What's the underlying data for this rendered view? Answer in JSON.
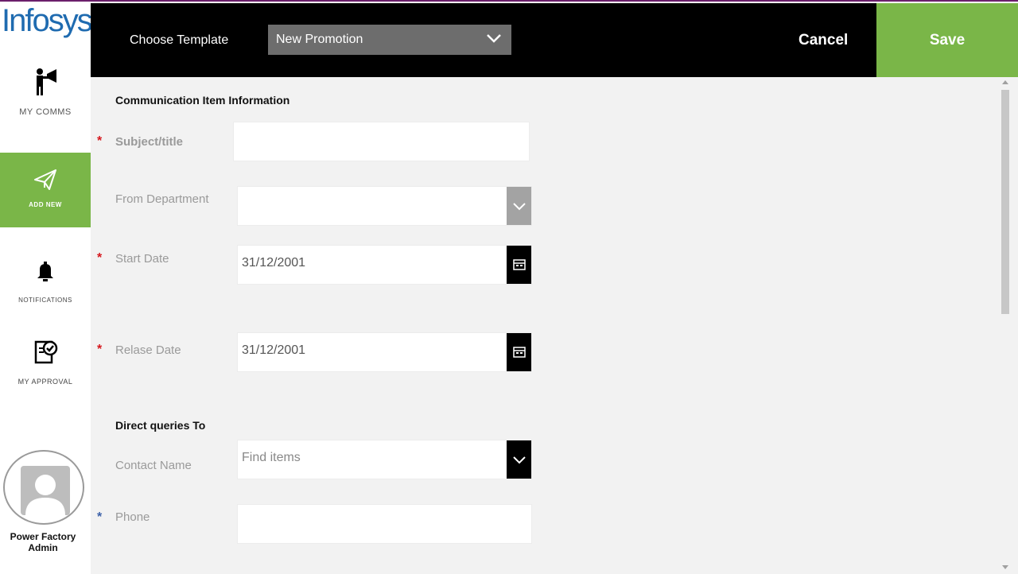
{
  "brand": {
    "logo_text": "Infosys"
  },
  "sidebar": {
    "items": [
      {
        "key": "mycomms",
        "label": "MY COMMS",
        "icon": "megaphone-person-icon"
      },
      {
        "key": "addnew",
        "label": "ADD NEW",
        "icon": "paper-plane-icon",
        "active": true
      },
      {
        "key": "notifications",
        "label": "NOTIFICATIONS",
        "icon": "bell-icon"
      },
      {
        "key": "approval",
        "label": "MY APPROVAL",
        "icon": "clipboard-check-icon"
      }
    ],
    "user": {
      "name_line1": "Power Factory",
      "name_line2": "Admin",
      "icon": "user-avatar-icon"
    }
  },
  "topbar": {
    "choose_label": "Choose Template",
    "template_value": "New Promotion",
    "cancel_label": "Cancel",
    "save_label": "Save"
  },
  "form": {
    "section1_title": "Communication Item Information",
    "subject_label": "Subject/title",
    "subject_value": "",
    "department_label": "From Department",
    "department_value": "",
    "start_label": "Start Date",
    "start_value": "31/12/2001",
    "release_label": "Relase Date",
    "release_value": "31/12/2001",
    "section2_title": "Direct queries  To",
    "contact_label": "Contact Name",
    "contact_placeholder": "Find items",
    "phone_label": "Phone",
    "phone_value": ""
  },
  "colors": {
    "accent_green": "#7ab648",
    "topbar_bg": "#000000",
    "logo_blue": "#1f6bb0",
    "required_red": "#d6161c"
  }
}
